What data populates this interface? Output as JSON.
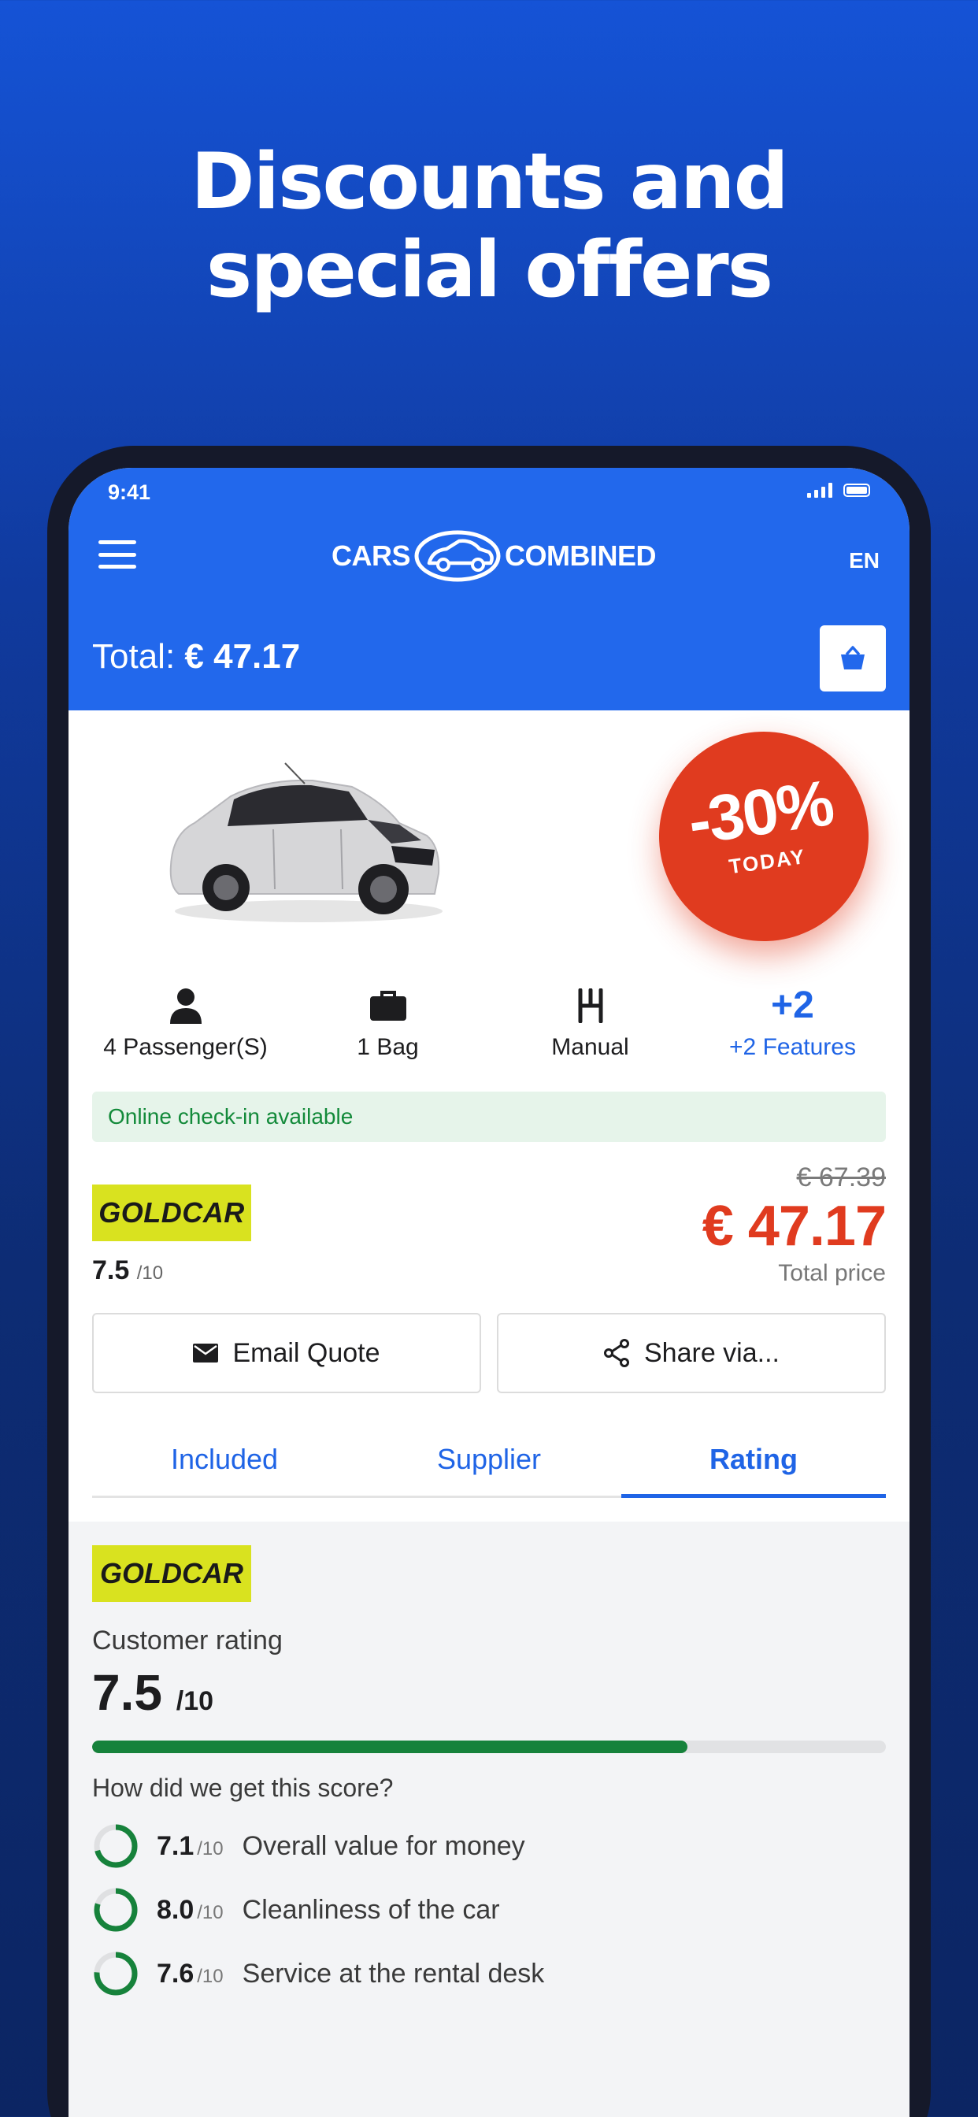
{
  "headline": {
    "line1": "Discounts and",
    "line2": "special offers"
  },
  "status_bar": {
    "time": "9:41"
  },
  "header": {
    "logo_left": "CARS",
    "logo_right": "COMBINED",
    "language": "EN",
    "total_label": "Total:",
    "total_value": "€ 47.17"
  },
  "offer_badge": {
    "percent": "-30%",
    "subtitle": "TODAY"
  },
  "features": [
    {
      "icon": "person-icon",
      "label": "4 Passenger(S)"
    },
    {
      "icon": "bag-icon",
      "label": "1 Bag"
    },
    {
      "icon": "gearshift-icon",
      "label": "Manual"
    },
    {
      "icon": "plus",
      "value": "+2",
      "label": "+2 Features"
    }
  ],
  "checkin_notice": "Online check-in available",
  "supplier": {
    "name": "GOLDCAR",
    "score": "7.5",
    "score_max": "/10"
  },
  "pricing": {
    "old_price": "€ 67.39",
    "price": "€ 47.17",
    "label": "Total price"
  },
  "actions": {
    "email": "Email Quote",
    "share": "Share via..."
  },
  "tabs": [
    {
      "label": "Included",
      "active": false
    },
    {
      "label": "Supplier",
      "active": false
    },
    {
      "label": "Rating",
      "active": true
    }
  ],
  "rating": {
    "supplier_name": "GOLDCAR",
    "title": "Customer rating",
    "score": "7.5",
    "score_max": "/10",
    "score_fraction": 0.75,
    "question": "How did we get this score?",
    "items": [
      {
        "value": "7.1",
        "max": "/10",
        "label": "Overall value for money",
        "fraction": 0.71
      },
      {
        "value": "8.0",
        "max": "/10",
        "label": "Cleanliness of the car",
        "fraction": 0.8
      },
      {
        "value": "7.6",
        "max": "/10",
        "label": "Service at the rental desk",
        "fraction": 0.76
      }
    ]
  },
  "colors": {
    "brand_blue": "#2268ec",
    "discount_red": "#e03b1f",
    "supplier_yellow": "#d9e21f",
    "rating_green": "#16823b"
  }
}
